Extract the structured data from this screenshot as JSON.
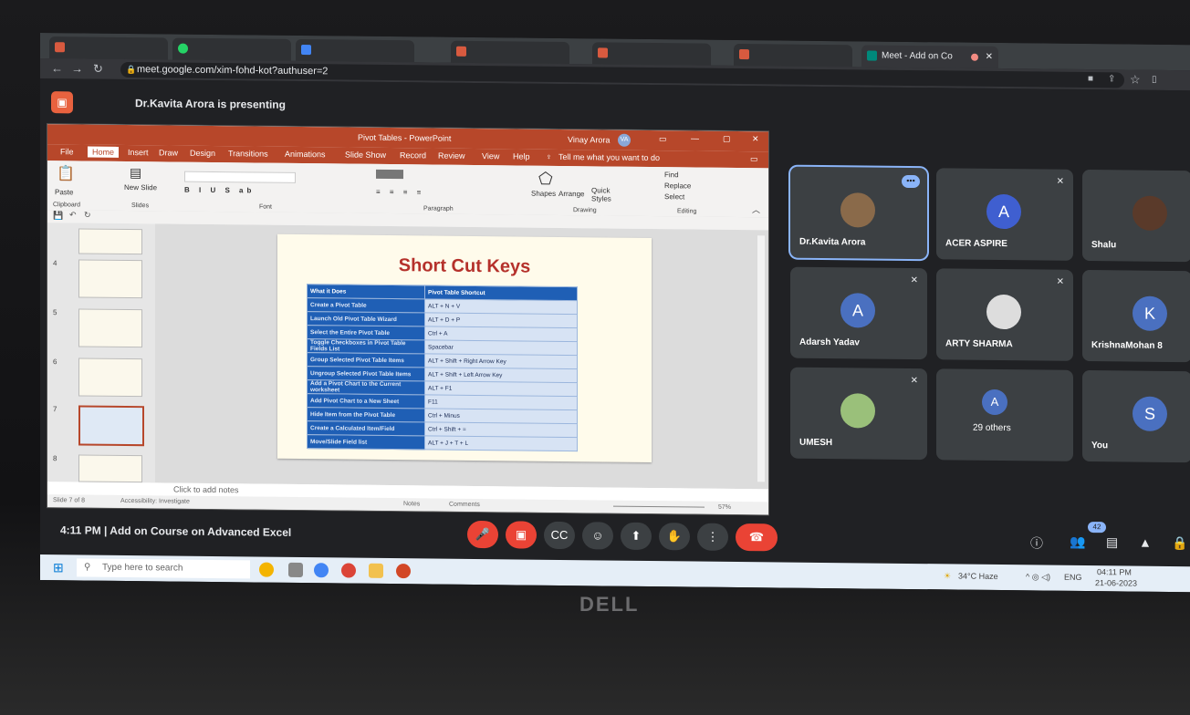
{
  "browser": {
    "tabs": [
      "Meet - Add on Co"
    ],
    "url": "meet.google.com/xim-fohd-kot?authuser=2"
  },
  "meet": {
    "presenting_text": "Dr.Kavita Arora is presenting",
    "time": "4:11 PM",
    "meeting_title": "Add on Course on Advanced Excel",
    "participant_count": "42",
    "participants": [
      {
        "name": "Dr.Kavita Arora",
        "avatar": ""
      },
      {
        "name": "ACER ASPIRE",
        "avatar": "A"
      },
      {
        "name": "Shalu",
        "avatar": ""
      },
      {
        "name": "Adarsh Yadav",
        "avatar": "A"
      },
      {
        "name": "ARTY SHARMA",
        "avatar": ""
      },
      {
        "name": "KrishnaMohan 8",
        "avatar": "K"
      },
      {
        "name": "UMESH",
        "avatar": ""
      },
      {
        "name": "29 others",
        "avatar": "A"
      },
      {
        "name": "You",
        "avatar": "S"
      }
    ]
  },
  "powerpoint": {
    "title": "Pivot Tables - PowerPoint",
    "user": "Vinay Arora",
    "user_initials": "VA",
    "menu": [
      "File",
      "Home",
      "Insert",
      "Draw",
      "Design",
      "Transitions",
      "Animations",
      "Slide Show",
      "Record",
      "Review",
      "View",
      "Help"
    ],
    "tell_me": "Tell me what you want to do",
    "ribbon_groups": [
      "Clipboard",
      "Slides",
      "Font",
      "Paragraph",
      "Drawing",
      "Editing"
    ],
    "ribbon_buttons": {
      "paste": "Paste",
      "new_slide": "New Slide",
      "shapes": "Shapes",
      "arrange": "Arrange",
      "quick_styles": "Quick Styles",
      "find": "Find",
      "replace": "Replace",
      "select": "Select"
    },
    "slide_numbers": [
      "4",
      "5",
      "6",
      "7",
      "8"
    ],
    "notes_placeholder": "Click to add notes",
    "status_left": "Slide 7 of 8",
    "accessibility": "Accessibility: Investigate",
    "status_notes": "Notes",
    "status_comments": "Comments",
    "zoom": "57%"
  },
  "slide": {
    "title": "Short Cut Keys",
    "table_headers": [
      "What it Does",
      "Pivot Table Shortcut"
    ],
    "rows": [
      [
        "Create a Pivot Table",
        "ALT + N + V"
      ],
      [
        "Launch Old Pivot Table Wizard",
        "ALT + D + P"
      ],
      [
        "Select the Entire Pivot Table",
        "Ctrl + A"
      ],
      [
        "Toggle Checkboxes in Pivot Table Fields List",
        "Spacebar"
      ],
      [
        "Group Selected Pivot Table Items",
        "ALT + Shift + Right Arrow Key"
      ],
      [
        "Ungroup Selected Pivot Table Items",
        "ALT + Shift + Left Arrow Key"
      ],
      [
        "Add a Pivot Chart to the Current worksheet",
        "ALT + F1"
      ],
      [
        "Add Pivot Chart to a New Sheet",
        "F11"
      ],
      [
        "Hide Item from the Pivot Table",
        "Ctrl + Minus"
      ],
      [
        "Create a Calculated Item/Field",
        "Ctrl + Shift + ="
      ],
      [
        "Move/Slide Field list",
        "ALT + J + T + L"
      ]
    ]
  },
  "taskbar": {
    "search_placeholder": "Type here to search",
    "weather": "34°C Haze",
    "lang": "ENG",
    "clock_time": "04:11 PM",
    "clock_date": "21-06-2023"
  },
  "laptop_brand": "DELL"
}
